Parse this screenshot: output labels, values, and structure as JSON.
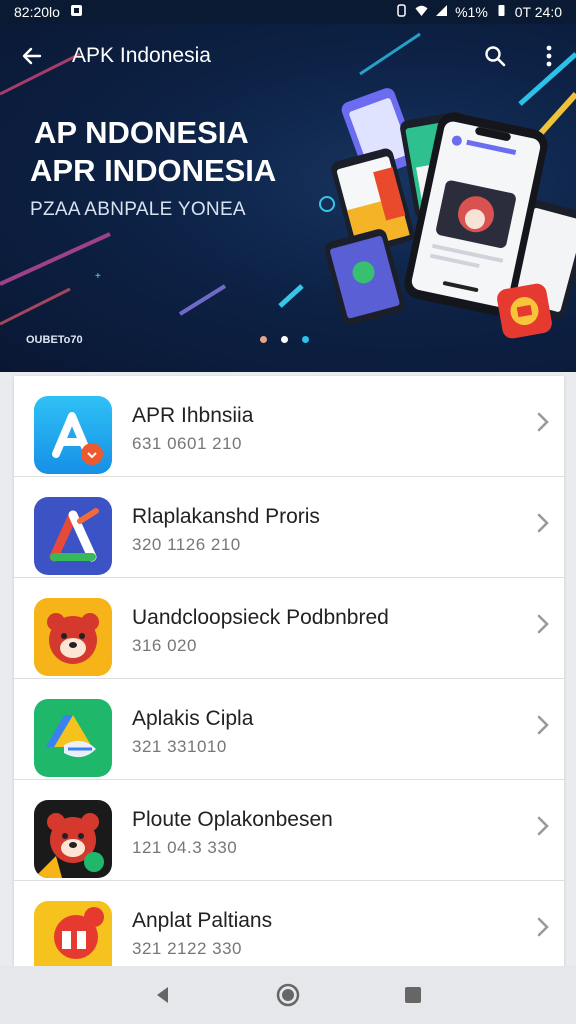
{
  "status_bar": {
    "left_text": "82:20lo",
    "battery_text": "%1%",
    "time": "0T 24:0"
  },
  "app_bar": {
    "title": "APK Indonesia"
  },
  "hero": {
    "headline_1": "AP NDONESIA",
    "headline_2": "APR INDONESIA",
    "subtitle": "PZAA ABNPALE YONEA",
    "caption": "OUBETo70",
    "active_dot_color": "#e7a487"
  },
  "apps": [
    {
      "name": "APR Ihbnsiia",
      "meta": "631  0601 210",
      "icon": "store-a-icon"
    },
    {
      "name": "Rlaplakanshd Proris",
      "meta": "320 1126 210",
      "icon": "triangle-a-icon"
    },
    {
      "name": "Uandcloopsieck Podbnbred",
      "meta": "316 020",
      "icon": "bear-icon"
    },
    {
      "name": "Aplakis Cipla",
      "meta": "321 331010",
      "icon": "drive-icon"
    },
    {
      "name": "Ploute Oplakonbesen",
      "meta": "121 04.3  330",
      "icon": "bear-dark-icon"
    },
    {
      "name": "Anplat Paltians",
      "meta": "321 2122 330",
      "icon": "gift-icon"
    }
  ],
  "colors": {
    "hero_bg": "#0d2246",
    "list_bg": "#ffffff",
    "nav_bg": "#e6e7ea"
  }
}
